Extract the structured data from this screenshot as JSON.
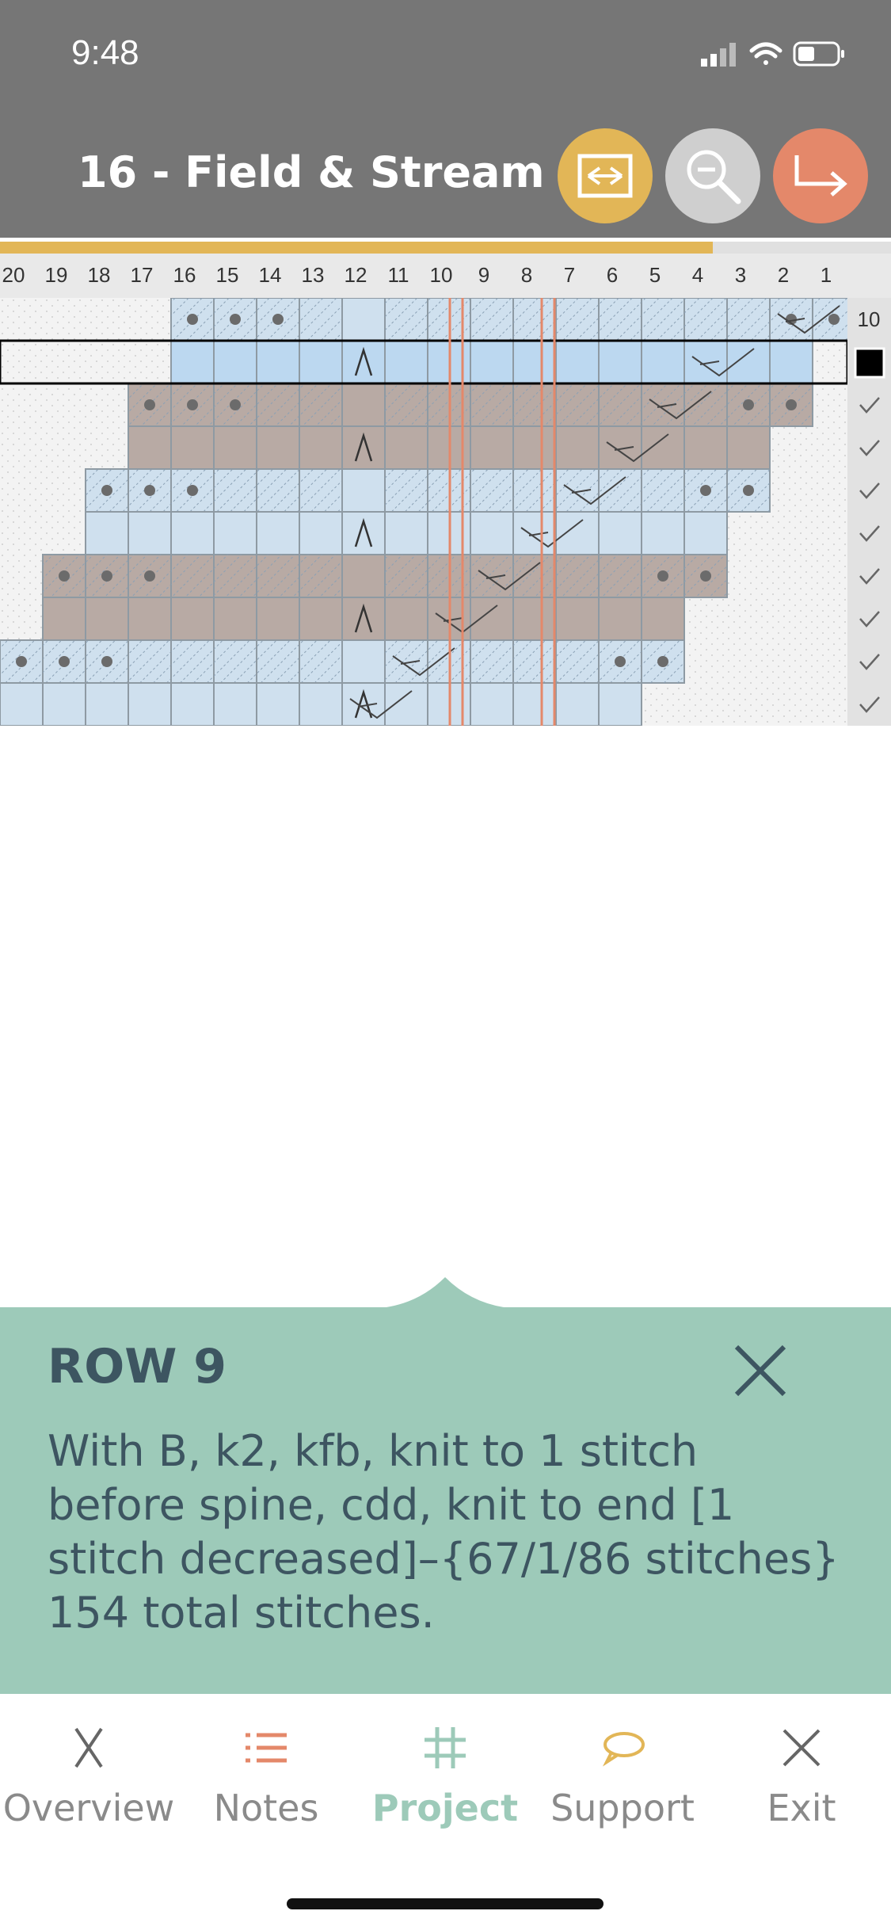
{
  "status": {
    "time": "9:48"
  },
  "header": {
    "title": "16 - Field & Stream"
  },
  "colors": {
    "header_bg": "#767676",
    "accent_yellow": "#e2b657",
    "accent_orange": "#e4886a",
    "button_grey": "#cfcfcf",
    "panel_green": "#9dcab9",
    "cell_blue": "#cfe0ee",
    "cell_taupe": "#b8aaa4"
  },
  "progress": {
    "fraction": 0.8
  },
  "chart_data": {
    "type": "table",
    "column_labels": [
      "20",
      "19",
      "18",
      "17",
      "16",
      "15",
      "14",
      "13",
      "12",
      "11",
      "10",
      "9",
      "8",
      "7",
      "6",
      "5",
      "4",
      "3",
      "2",
      "1"
    ],
    "current_row": 10,
    "rows": [
      "10",
      "",
      "",
      "",
      "",
      "",
      "",
      "",
      "",
      ""
    ],
    "completed_rows": 8
  },
  "instruction": {
    "row_title": "ROW 9",
    "text": "With B, k2, kfb, knit to 1 stitch before spine, cdd, knit to end [1 stitch decreased]–{67/1/86 stitches} 154 total stitches."
  },
  "tabs": [
    {
      "label": "Overview",
      "icon": "needles-icon"
    },
    {
      "label": "Notes",
      "icon": "list-icon"
    },
    {
      "label": "Project",
      "icon": "grid-icon",
      "active": true
    },
    {
      "label": "Support",
      "icon": "chat-icon"
    },
    {
      "label": "Exit",
      "icon": "close-icon"
    }
  ]
}
